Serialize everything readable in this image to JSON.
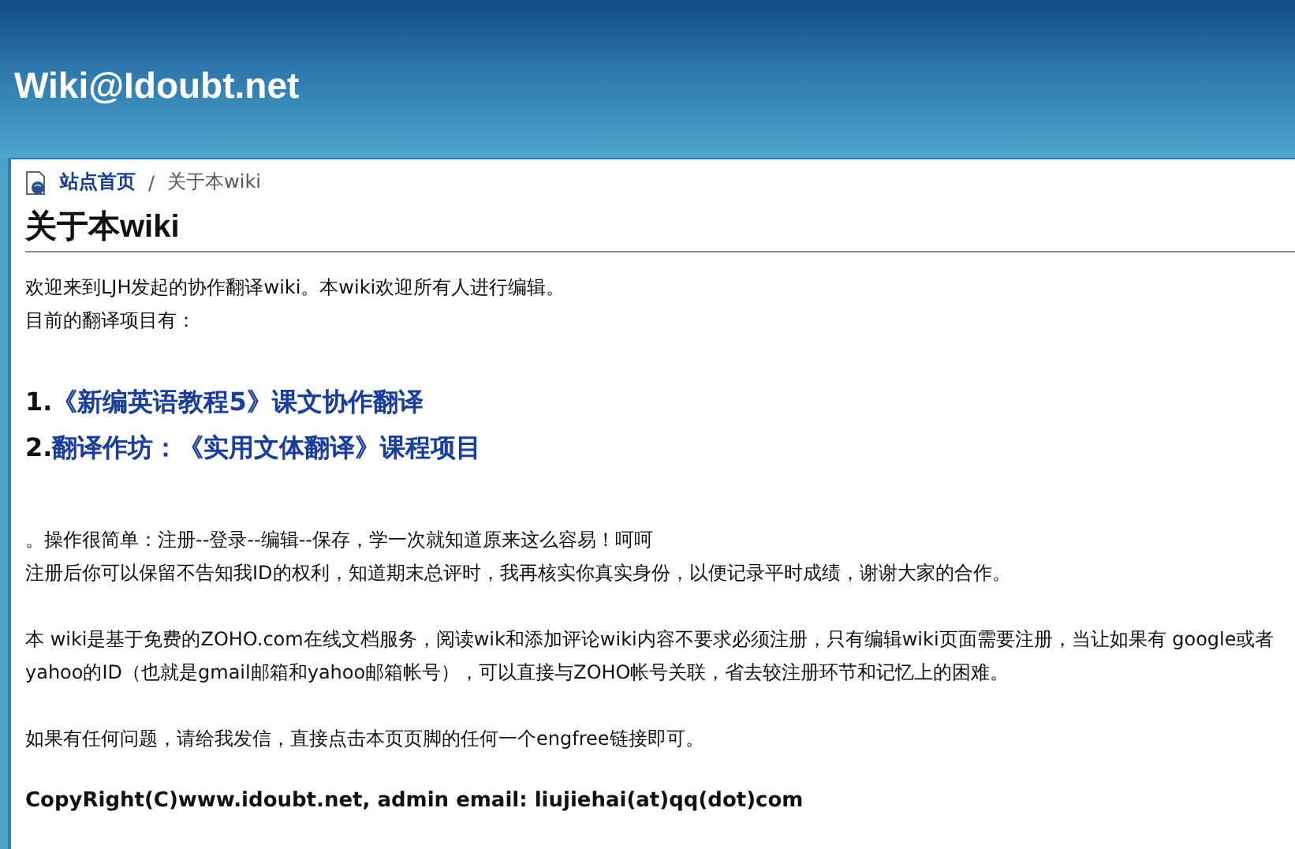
{
  "site_title": "Wiki@Idoubt.net",
  "breadcrumb": {
    "home": "站点首页",
    "separator": "/",
    "current": "关于本wiki"
  },
  "page_title": "关于本wiki",
  "intro": [
    "欢迎来到LJH发起的协作翻译wiki。本wiki欢迎所有人进行编辑。",
    "目前的翻译项目有："
  ],
  "projects": [
    {
      "number": "1.",
      "title": "《新编英语教程5》课文协作翻译"
    },
    {
      "number": "2.",
      "title": "翻译作坊：《实用文体翻译》课程项目"
    }
  ],
  "paragraphs": [
    [
      "。操作很简单：注册--登录--编辑--保存，学一次就知道原来这么容易！呵呵",
      "注册后你可以保留不告知我ID的权利，知道期末总评时，我再核实你真实身份，以便记录平时成绩，谢谢大家的合作。"
    ],
    [
      "本 wiki是基于免费的ZOHO.com在线文档服务，阅读wik和添加评论wiki内容不要求必须注册，只有编辑wiki页面需要注册，当让如果有 google或者yahoo的ID（也就是gmail邮箱和yahoo邮箱帐号），可以直接与ZOHO帐号关联，省去较注册环节和记忆上的困难。"
    ],
    [
      "如果有任何问题，请给我发信，直接点击本页页脚的任何一个engfree链接即可。"
    ]
  ],
  "copyright": "CopyRight(C)www.idoubt.net, admin email: liujiehai(at)qq(dot)com"
}
